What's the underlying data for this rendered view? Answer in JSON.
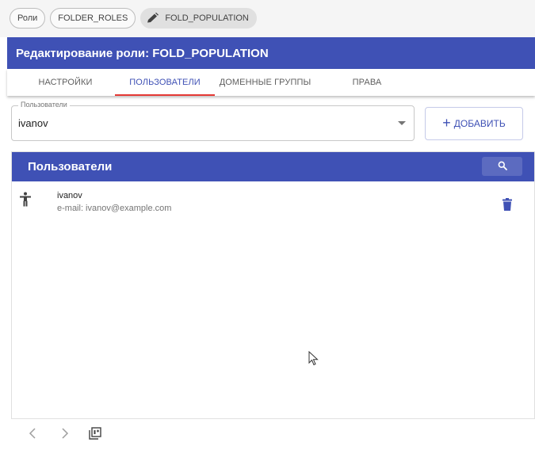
{
  "breadcrumb": {
    "items": [
      {
        "label": "Роли"
      },
      {
        "label": "FOLDER_ROLES"
      },
      {
        "label": "FOLD_POPULATION",
        "icon": "pencil-icon"
      }
    ]
  },
  "header": {
    "title": "Редактирование роли: FOLD_POPULATION"
  },
  "tabs": [
    {
      "label": "НАСТРОЙКИ",
      "active": false
    },
    {
      "label": "ПОЛЬЗОВАТЕЛИ",
      "active": true
    },
    {
      "label": "ДОМЕННЫЕ ГРУППЫ",
      "active": false
    },
    {
      "label": "ПРАВА",
      "active": false
    }
  ],
  "users_select": {
    "label": "Пользователи",
    "value": "ivanov"
  },
  "add_button": {
    "label": "ДОБАВИТЬ",
    "icon": "plus-icon"
  },
  "panel": {
    "title": "Пользователи",
    "search_icon": "search-icon",
    "items": [
      {
        "name": "ivanov",
        "email": "e-mail: ivanov@example.com",
        "icon": "person-icon",
        "action_icon": "trash-icon"
      }
    ]
  },
  "footer": {
    "icons": [
      "chevron-left-icon",
      "chevron-right-icon",
      "page-size-icon"
    ]
  },
  "colors": {
    "primary": "#3f51b5",
    "tab_indicator": "#e53935",
    "search_button": "#5c6bc0"
  }
}
